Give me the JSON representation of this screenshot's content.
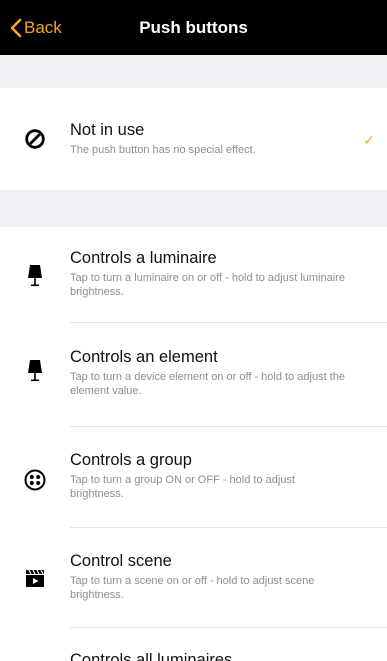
{
  "navbar": {
    "back_label": "Back",
    "title": "Push buttons"
  },
  "rows": [
    {
      "title": "Not in use",
      "desc": "The push button has no special effect.",
      "icon": "prohibited-icon",
      "checked": true
    },
    {
      "title": "Controls a luminaire",
      "desc": "Tap to turn a luminaire on or off - hold to adjust luminaire brightness.",
      "icon": "lamp-icon"
    },
    {
      "title": "Controls an element",
      "desc": "Tap to turn a device element on or off - hold to adjust the element value.",
      "icon": "lamp-icon"
    },
    {
      "title": "Controls a group",
      "desc": "Tap to turn a group ON or OFF - hold to adjust brightness.",
      "icon": "group-icon"
    },
    {
      "title": "Control scene",
      "desc": "Tap to turn a scene on or off - hold to adjust scene brightness.",
      "icon": "scene-clapper-icon"
    },
    {
      "title": "Controls all luminaires"
    }
  ],
  "check_glyph": "✓",
  "colors": {
    "accent": "#f5a623",
    "navbar": "#000000",
    "group_bg": "#efeff4"
  }
}
